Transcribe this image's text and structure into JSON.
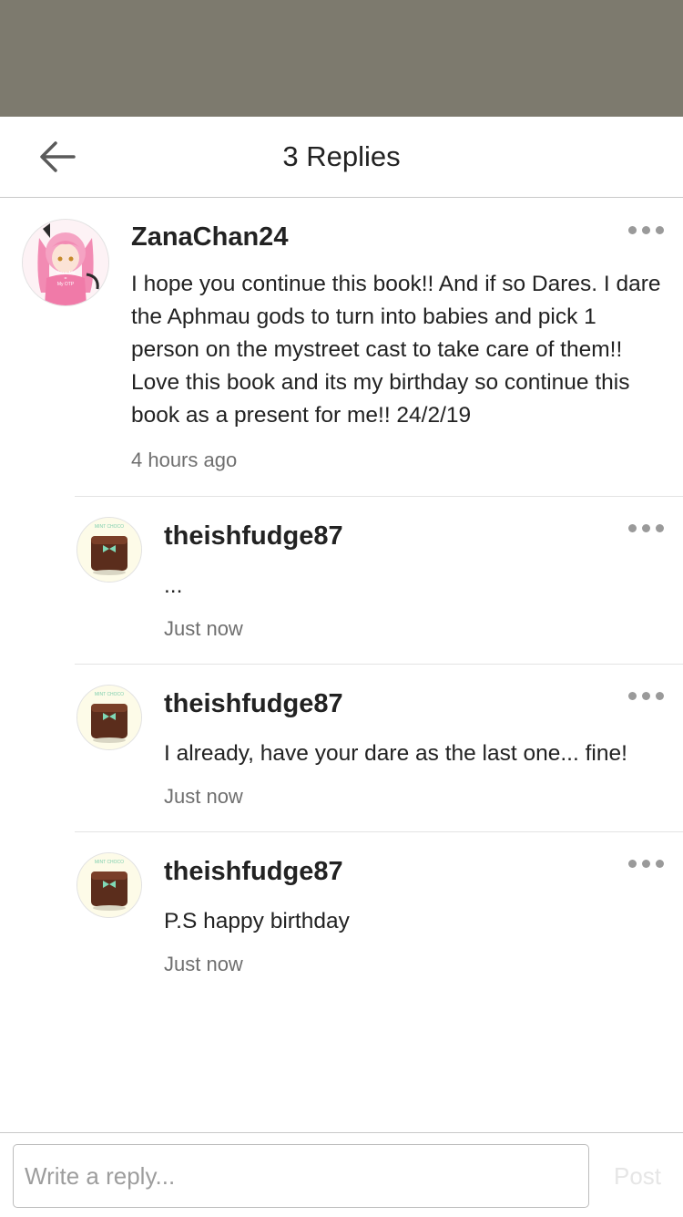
{
  "header": {
    "title": "3 Replies",
    "back_icon": "arrow-left-icon"
  },
  "parent_comment": {
    "username": "ZanaChan24",
    "text": "I hope you continue this book!! And if so Dares. I dare the Aphmau gods to turn into babies and pick 1 person on the mystreet cast to take care of them!! Love this book and its my birthday so continue this book as a present for me!! 24/2/19",
    "time": "4 hours ago",
    "avatar_text": [
      "You + Me",
      "=",
      "My OTP"
    ]
  },
  "replies": [
    {
      "username": "theishfudge87",
      "text": "...",
      "time": "Just now",
      "avatar_caption": "MINT CHOCO"
    },
    {
      "username": "theishfudge87",
      "text": "I already, have your dare as the last one... fine!",
      "time": "Just now",
      "avatar_caption": "MINT CHOCO"
    },
    {
      "username": "theishfudge87",
      "text": "P.S happy birthday",
      "time": "Just now",
      "avatar_caption": "MINT CHOCO"
    }
  ],
  "reply_bar": {
    "placeholder": "Write a reply...",
    "post_label": "Post"
  },
  "colors": {
    "status_bar": "#7d7a6e",
    "text": "#222222",
    "muted": "#6f6f6f",
    "more_dots": "#9a9a9a",
    "post_disabled": "#e6e6e6"
  },
  "icons": {
    "more": "more-horizontal-icon"
  }
}
